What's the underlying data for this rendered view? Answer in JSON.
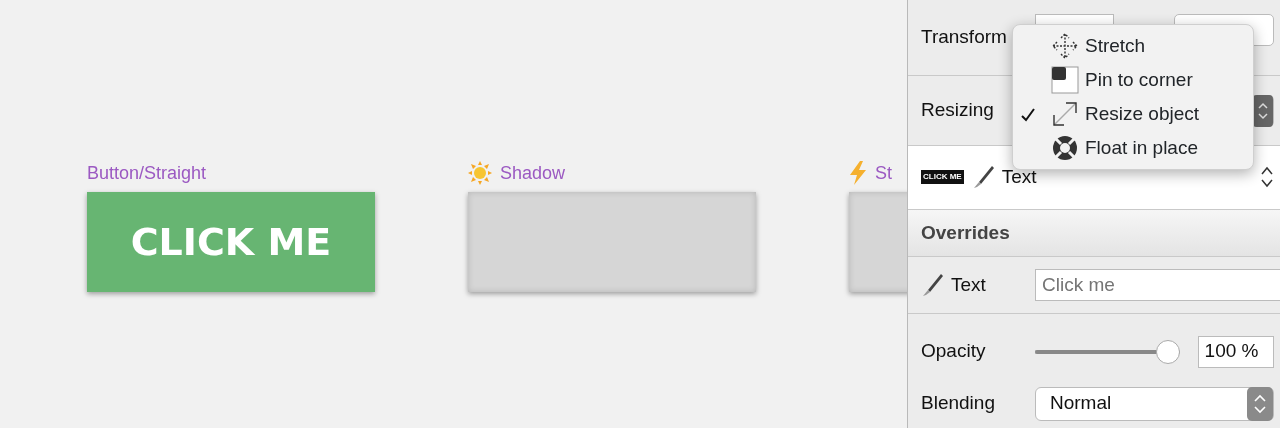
{
  "canvas": {
    "artboards": [
      {
        "label": "Button/Straight",
        "kind": "green",
        "text": "CLICK ME"
      },
      {
        "label": "Shadow",
        "kind": "grey"
      },
      {
        "label": "St",
        "kind": "grey"
      }
    ]
  },
  "inspector": {
    "transform": {
      "label": "Transform"
    },
    "resizing": {
      "label": "Resizing"
    },
    "symbol": {
      "thumbnail_text": "CLICK ME",
      "label": "Text"
    },
    "overrides": {
      "title": "Overrides",
      "rows": [
        {
          "label": "Text",
          "placeholder": "Click me"
        }
      ]
    },
    "opacity": {
      "label": "Opacity",
      "level": 1,
      "value": "100 %"
    },
    "blending": {
      "label": "Blending",
      "value": "Normal"
    }
  },
  "resize_menu": {
    "items": [
      {
        "label": "Stretch",
        "checked": false
      },
      {
        "label": "Pin to corner",
        "checked": false
      },
      {
        "label": "Resize object",
        "checked": true
      },
      {
        "label": "Float in place",
        "checked": false
      }
    ]
  }
}
